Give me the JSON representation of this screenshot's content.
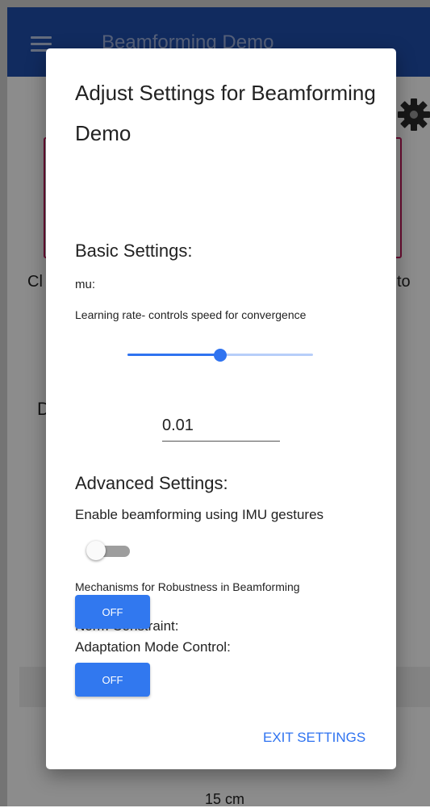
{
  "app": {
    "title": "Beamforming Demo",
    "bg_text_left": "Cl",
    "bg_text_right": "to",
    "bg_text_mid": "D",
    "bg_measure": "15 cm"
  },
  "dialog": {
    "title": "Adjust Settings for Beamforming Demo",
    "basic_heading": "Basic Settings:",
    "mu_label": "mu:",
    "mu_description": "Learning rate- controls speed for convergence",
    "mu_slider_fraction": 0.5,
    "mu_value": "0.01",
    "advanced_heading": "Advanced Settings:",
    "imu_label": "Enable beamforming using IMU gestures",
    "imu_enabled": false,
    "mechanisms_label": "Mechanisms for Robustness in Beamforming",
    "norm_label": "Norm Constraint:",
    "norm_button": "OFF",
    "adapt_label": "Adaptation Mode Control:",
    "adapt_button": "OFF",
    "exit_button": "EXIT SETTINGS"
  },
  "colors": {
    "appbar": "#1f4fae",
    "accent": "#2f73f0",
    "card_border": "#c2185b"
  },
  "icons": {
    "menu": "hamburger-menu-icon",
    "settings": "gear-icon"
  }
}
